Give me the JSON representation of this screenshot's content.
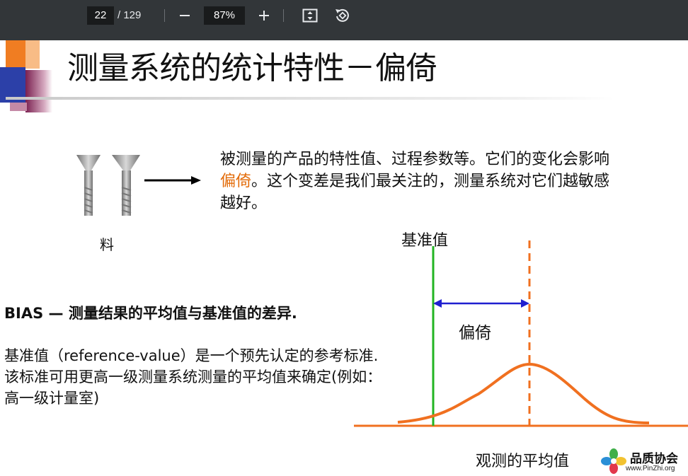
{
  "toolbar": {
    "page_current": "22",
    "page_total": "/ 129",
    "zoom": "87%"
  },
  "slide": {
    "title": "测量系统的统计特性－偏倚",
    "desc_part1": "被测量的产品的特性值、过程参数等。它们的变化会影响",
    "desc_highlight": "偏倚",
    "desc_part2": "。这个变差是我们最关注的，测量系统对它们越敏感越好。",
    "material_label": "料",
    "bias_heading": "BIAS — 测量结果的平均值与基准值的差异.",
    "bias_definition": "基准值（reference-value）是一个预先认定的参考标准. 该标准可用更高一级测量系统测量的平均值来确定(例如：高一级计量室)",
    "ref_value_label": "基准值",
    "bias_label": "偏倚",
    "x_axis_label": "观测的平均值",
    "logo_cn": "品质协会",
    "logo_en": "www.PinZhi.org"
  },
  "colors": {
    "highlight": "#e36c0a",
    "curve": "#f07020",
    "reference_line": "#22b422",
    "bias_arrow": "#1f1fd0",
    "toolbar_bg": "#323639"
  },
  "icons": [
    "minus-icon",
    "plus-icon",
    "fit-page-icon",
    "rotate-icon",
    "screw-icon",
    "right-arrow-icon",
    "logo-flower-icon"
  ]
}
